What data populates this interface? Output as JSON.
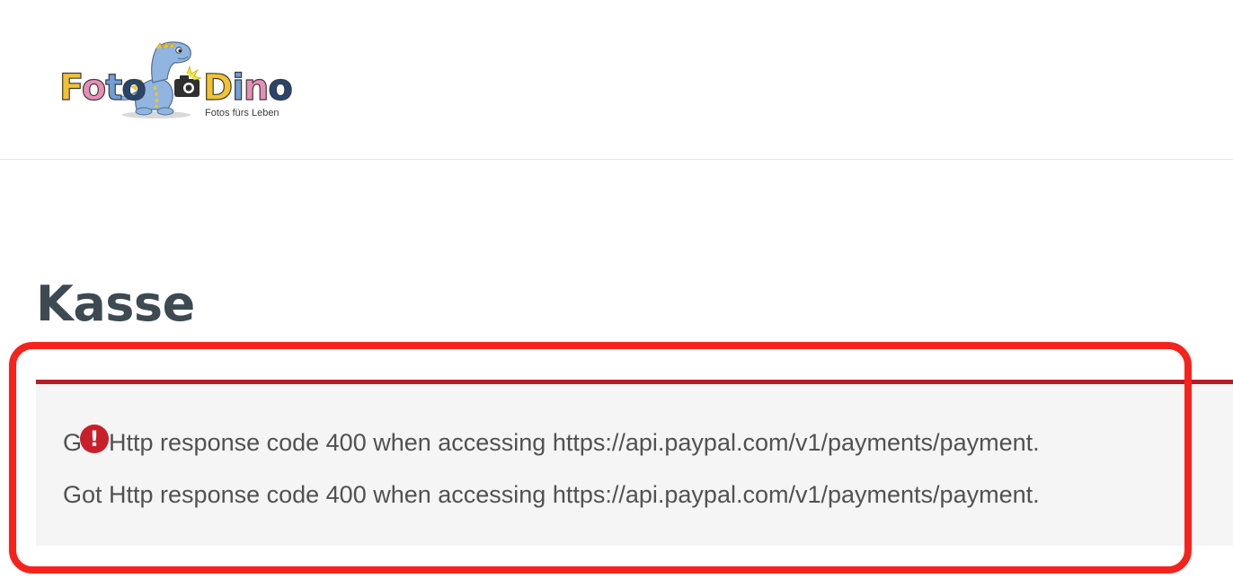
{
  "header": {
    "logo": {
      "word_foto": "Foto",
      "word_dino": "Dino",
      "tagline": "Fotos fürs Leben",
      "colors": {
        "yellow": "#f2c230",
        "pink": "#e78fb3",
        "blue": "#6f9fd8",
        "navy": "#27456e",
        "dino": "#8fb5e0"
      }
    }
  },
  "page": {
    "title": "Kasse"
  },
  "notice": {
    "type": "error",
    "accent_color": "#b81c23",
    "icon": "exclamation-circle-icon",
    "messages": [
      "Got Http response code 400 when accessing https://api.paypal.com/v1/payments/payment.",
      "Got Http response code 400 when accessing https://api.paypal.com/v1/payments/payment."
    ]
  },
  "annotation": {
    "highlight_color": "#f5231c"
  }
}
